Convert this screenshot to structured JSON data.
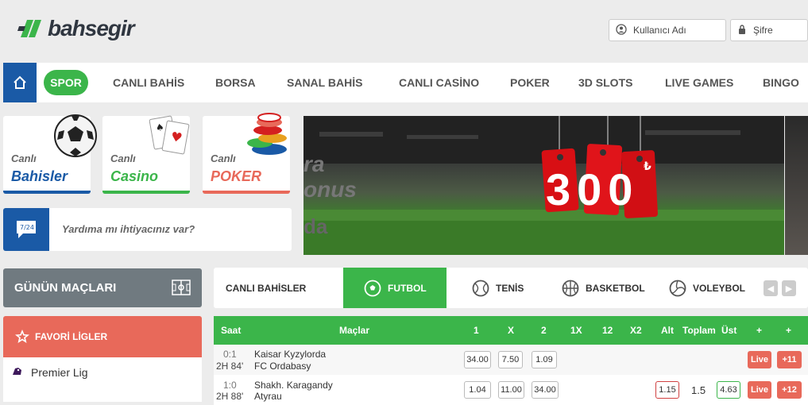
{
  "header": {
    "logo_text": "bahsegir",
    "username_placeholder": "Kullanıcı Adı",
    "password_placeholder": "Şifre"
  },
  "nav": {
    "items": [
      "SPOR",
      "CANLI BAHİS",
      "BORSA",
      "SANAL BAHİS",
      "CANLI CASİNO",
      "POKER",
      "3D SLOTS",
      "LIVE GAMES",
      "BINGO"
    ]
  },
  "cards": [
    {
      "line1": "Canlı",
      "line2": "Bahisler",
      "color": "#1a5aa6"
    },
    {
      "line1": "Canlı",
      "line2": "Casino",
      "color": "#3bb54a"
    },
    {
      "line1": "Canlı",
      "line2": "POKER",
      "color": "#e8695a"
    }
  ],
  "help": {
    "badge": "7/24",
    "text": "Yardıma mı ihtiyacınız var?"
  },
  "banner": {
    "amount": "300",
    "currency": "₺",
    "left_text_1": "ra",
    "left_text_2": "onus",
    "left_text_3": "da"
  },
  "sidebar": {
    "today_title": "GÜNÜN MAÇLARI",
    "fav_title": "FAVORİ LİGLER",
    "leagues": [
      "Premier Lig"
    ]
  },
  "tabs": [
    "CANLI BAHİSLER",
    "FUTBOL",
    "TENİS",
    "BASKETBOL",
    "VOLEYBOL"
  ],
  "table": {
    "headers": [
      "Saat",
      "Maçlar",
      "1",
      "X",
      "2",
      "1X",
      "12",
      "X2",
      "Alt",
      "Toplam",
      "Üst",
      "+",
      "+"
    ],
    "rows": [
      {
        "score": "0:1",
        "time": "2H 84'",
        "home": "Kaisar Kyzylorda",
        "away": "FC Ordabasy",
        "o1": "34.00",
        "ox": "7.50",
        "o2": "1.09",
        "alt": "",
        "total": "",
        "ust": "",
        "live": "Live",
        "more": "+11"
      },
      {
        "score": "1:0",
        "time": "2H 88'",
        "home": "Shakh. Karagandy",
        "away": "Atyrau",
        "o1": "1.04",
        "ox": "11.00",
        "o2": "34.00",
        "alt": "1.15",
        "total": "1.5",
        "ust": "4.63",
        "live": "Live",
        "more": "+12"
      }
    ]
  },
  "colors": {
    "green": "#3bb54a",
    "blue": "#1a5aa6",
    "coral": "#e8695a",
    "grey": "#707a80"
  }
}
